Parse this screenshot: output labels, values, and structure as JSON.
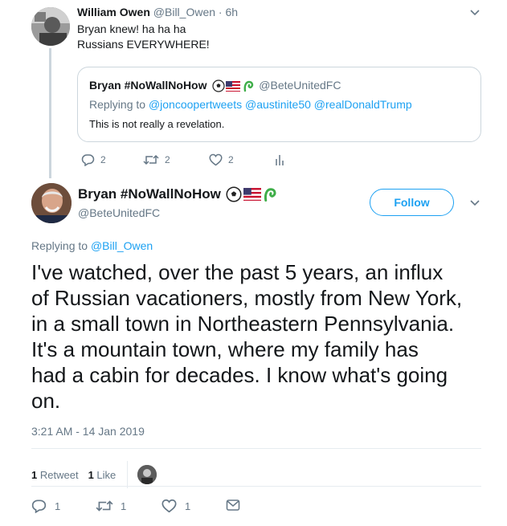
{
  "reply_tweet": {
    "name": "William Owen",
    "handle": "@Bill_Owen",
    "time": "· 6h",
    "lines": [
      "Bryan knew! ha ha ha",
      "Russians EVERYWHERE!"
    ],
    "quote": {
      "name": "Bryan #NoWallNoHow",
      "handle": "@BeteUnitedFC",
      "replying_label": "Replying to",
      "replying_to": "@joncoopertweets @austinite50 @realDonaldTrump",
      "text": "This is not really a revelation."
    },
    "actions": {
      "replies": "2",
      "retweets": "2",
      "likes": "2"
    }
  },
  "main_tweet": {
    "name": "Bryan #NoWallNoHow",
    "handle": "@BeteUnitedFC",
    "follow_label": "Follow",
    "replying_label": "Replying to",
    "replying_to": "@Bill_Owen",
    "text_lines": [
      "I've watched, over the past 5 years, an influx",
      "of Russian vacationers, mostly from New York,",
      "in a small town in Northeastern Pennsylvania.",
      "It's a mountain town, where my family has",
      "had a cabin for decades.  I know what's going",
      "on."
    ],
    "timestamp": "3:21 AM - 14 Jan 2019",
    "stats": {
      "retweets_count": "1",
      "retweets_label": "Retweet",
      "likes_count": "1",
      "likes_label": "Like"
    },
    "actions": {
      "replies": "1",
      "retweets": "1",
      "likes": "1"
    }
  },
  "colors": {
    "accent": "#1da1f2",
    "muted": "#657786",
    "border": "#ccd6dd",
    "text": "#14171a"
  },
  "icons": [
    "reply-icon",
    "retweet-icon",
    "like-icon",
    "analytics-icon",
    "message-icon",
    "chevron-down-icon",
    "soccer-ball-icon",
    "us-flag-icon",
    "green-logo-icon"
  ]
}
